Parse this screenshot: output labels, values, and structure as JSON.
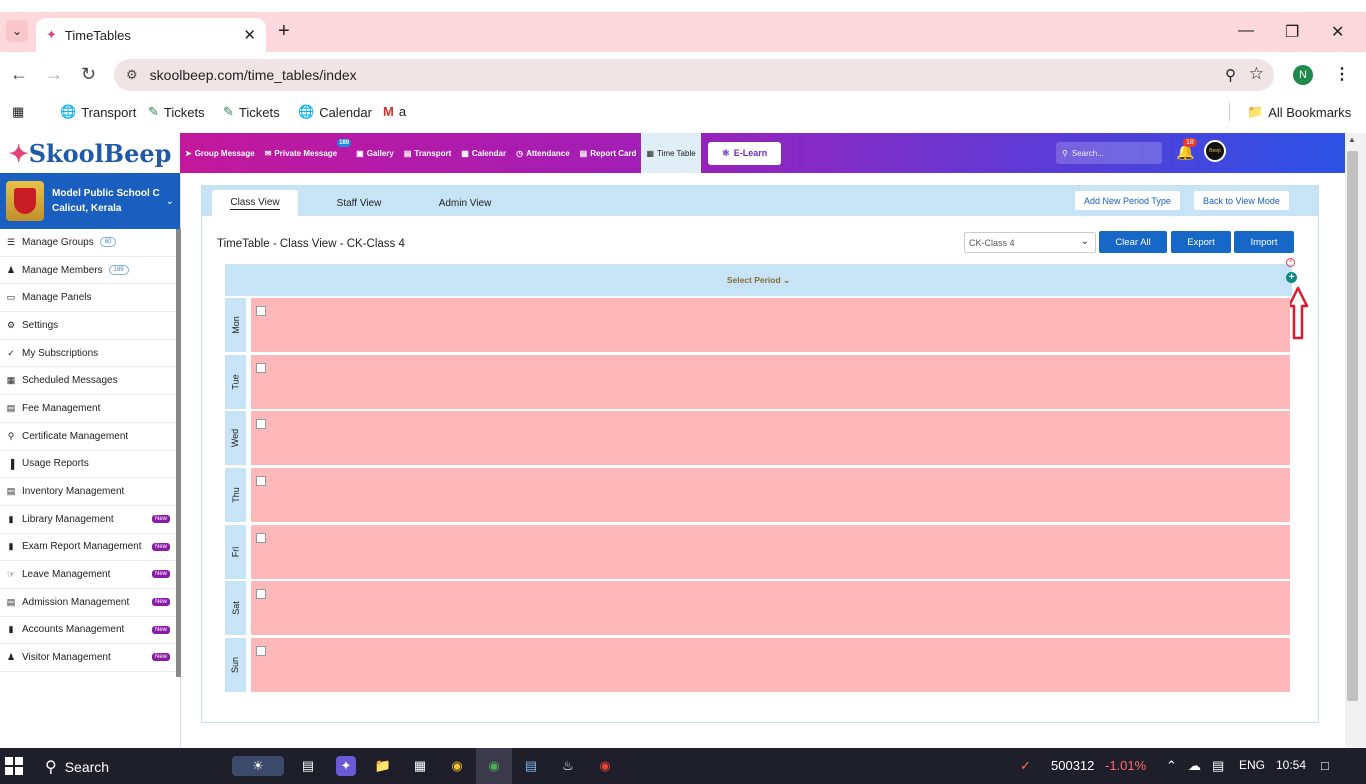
{
  "browser": {
    "tab_title": "TimeTables",
    "url": "skoolbeep.com/time_tables/index",
    "profile_initial": "N",
    "bookmarks": [
      "Transport",
      "Tickets",
      "Tickets",
      "Calendar",
      "a"
    ],
    "all_bookmarks": "All Bookmarks"
  },
  "app": {
    "logo": "SkoolBeep",
    "nav": [
      {
        "label": "Group Message",
        "icon": "send-icon"
      },
      {
        "label": "Private Message",
        "icon": "mail-icon",
        "badge": "189"
      },
      {
        "label": "Gallery",
        "icon": "image-icon"
      },
      {
        "label": "Transport",
        "icon": "bus-icon"
      },
      {
        "label": "Calendar",
        "icon": "calendar-icon"
      },
      {
        "label": "Attendance",
        "icon": "clock-icon"
      },
      {
        "label": "Report Card",
        "icon": "report-icon"
      },
      {
        "label": "Time Table",
        "icon": "timetable-icon"
      }
    ],
    "elearn": "E-Learn",
    "search_placeholder": "Search...",
    "notification_count": "18",
    "avatar_text": "Beep"
  },
  "sidebar": {
    "school_name": "Model Public School C",
    "school_location": "Calicut, Kerala",
    "items": [
      {
        "label": "Manage Groups",
        "count": "60",
        "icon": "list-icon"
      },
      {
        "label": "Manage Members",
        "count": "189",
        "icon": "users-icon"
      },
      {
        "label": "Manage Panels",
        "icon": "monitor-icon"
      },
      {
        "label": "Settings",
        "icon": "gear-icon"
      },
      {
        "label": "My Subscriptions",
        "icon": "check-icon"
      },
      {
        "label": "Scheduled Messages",
        "icon": "calendar-icon"
      },
      {
        "label": "Fee Management",
        "icon": "file-icon"
      },
      {
        "label": "Certificate Management",
        "icon": "award-icon"
      },
      {
        "label": "Usage Reports",
        "icon": "bar-chart-icon"
      },
      {
        "label": "Inventory Management",
        "icon": "inventory-icon"
      },
      {
        "label": "Library Management",
        "icon": "book-icon",
        "new": "New"
      },
      {
        "label": "Exam Report Management",
        "icon": "file-icon",
        "new": "New"
      },
      {
        "label": "Leave Management",
        "icon": "leave-icon",
        "new": "New"
      },
      {
        "label": "Admission Management",
        "icon": "id-card-icon",
        "new": "New"
      },
      {
        "label": "Accounts Management",
        "icon": "file-icon",
        "new": "New"
      },
      {
        "label": "Visitor Management",
        "icon": "users-icon",
        "new": "New"
      }
    ]
  },
  "timetable": {
    "tabs": [
      "Class View",
      "Staff View",
      "Admin View"
    ],
    "add_period_type": "Add New Period Type",
    "back_to_view": "Back to View Mode",
    "title": "TimeTable - Class View - CK-Class 4",
    "class_selected": "CK-Class 4",
    "clear_all": "Clear All",
    "export": "Export",
    "import": "Import",
    "select_period": "Select Period",
    "days": [
      "Mon",
      "Tue",
      "Wed",
      "Thu",
      "Fri",
      "Sat",
      "Sun"
    ]
  },
  "taskbar": {
    "search": "Search",
    "stock_code": "500312",
    "stock_change": "-1.01%",
    "lang": "ENG",
    "time": "10:54"
  },
  "colors": {
    "nav_gradient_start": "#c2189c",
    "nav_gradient_end": "#2b52e6",
    "school_card": "#1a5ebf",
    "light_blue": "#c6e4f6",
    "day_cell": "#ffb8ba",
    "action_button": "#1767c7",
    "new_badge": "#8b1aa6"
  }
}
